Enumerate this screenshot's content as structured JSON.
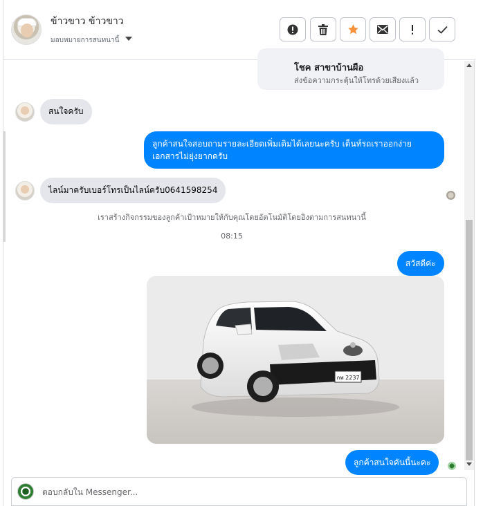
{
  "header": {
    "name": "ข้าวขาว ข้าวขาว",
    "assign_label": "มอบหมายการสนทนานี้"
  },
  "header_actions": [
    {
      "name": "spam-icon",
      "glyph": "!"
    },
    {
      "name": "trash-icon"
    },
    {
      "name": "star-icon"
    },
    {
      "name": "mail-icon"
    },
    {
      "name": "alert-icon",
      "glyph": "!"
    },
    {
      "name": "check-icon"
    }
  ],
  "card_top": {
    "title": "โชค สาขาบ้านผือ",
    "subtitle": "ส่งข้อความกระตุ้นให้โทรด้วยเสียงแล้ว"
  },
  "messages": [
    {
      "from": "customer",
      "text": "สนใจครับ"
    },
    {
      "from": "page",
      "text": "ลูกค้าสนใจสอบถามรายละเอียดเพิ่มเติมได้เลยนะครับ เต็นท์รถเราออกง่ายเอกสารไม่ยุ่งยากครับ"
    },
    {
      "from": "customer",
      "text": "ไลน์มาครับเบอร์โทรเป็นไลน์ครับ0641598254"
    },
    {
      "from": "page",
      "text": "สวัสดีค่ะ"
    },
    {
      "from": "page",
      "text": "ลูกค้าสนใจคันนี้นะคะ"
    }
  ],
  "system_note": "เราสร้างกิจกรรมของลูกค้าเป้าหมายให้กับคุณโดยอัตโนมัติโดยอิงตามการสนทนานี้",
  "timestamp": "08:15",
  "car_photo": {
    "plate": "กพ 2237",
    "color": "white"
  },
  "composer": {
    "placeholder": "ตอบกลับใน Messenger..."
  },
  "colors": {
    "outgoing": "#0084ff",
    "incoming": "#e4e6eb",
    "star": "#f7923a"
  }
}
